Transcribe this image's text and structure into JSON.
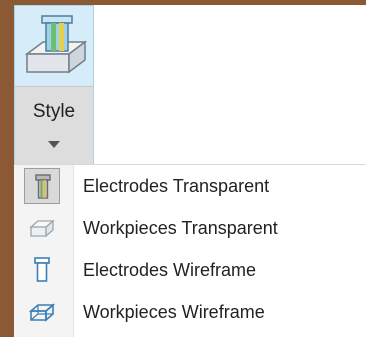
{
  "ribbon": {
    "style_button": {
      "label": "Style",
      "icon": "electrode-workpiece-style-icon"
    }
  },
  "menu": {
    "items": [
      {
        "label": "Electrodes Transparent",
        "icon": "electrode-transparent-icon",
        "checked": true
      },
      {
        "label": "Workpieces Transparent",
        "icon": "workpiece-transparent-icon",
        "checked": false
      },
      {
        "label": "Electrodes Wireframe",
        "icon": "electrode-wireframe-icon",
        "checked": false
      },
      {
        "label": "Workpieces Wireframe",
        "icon": "workpiece-wireframe-icon",
        "checked": false
      }
    ]
  }
}
